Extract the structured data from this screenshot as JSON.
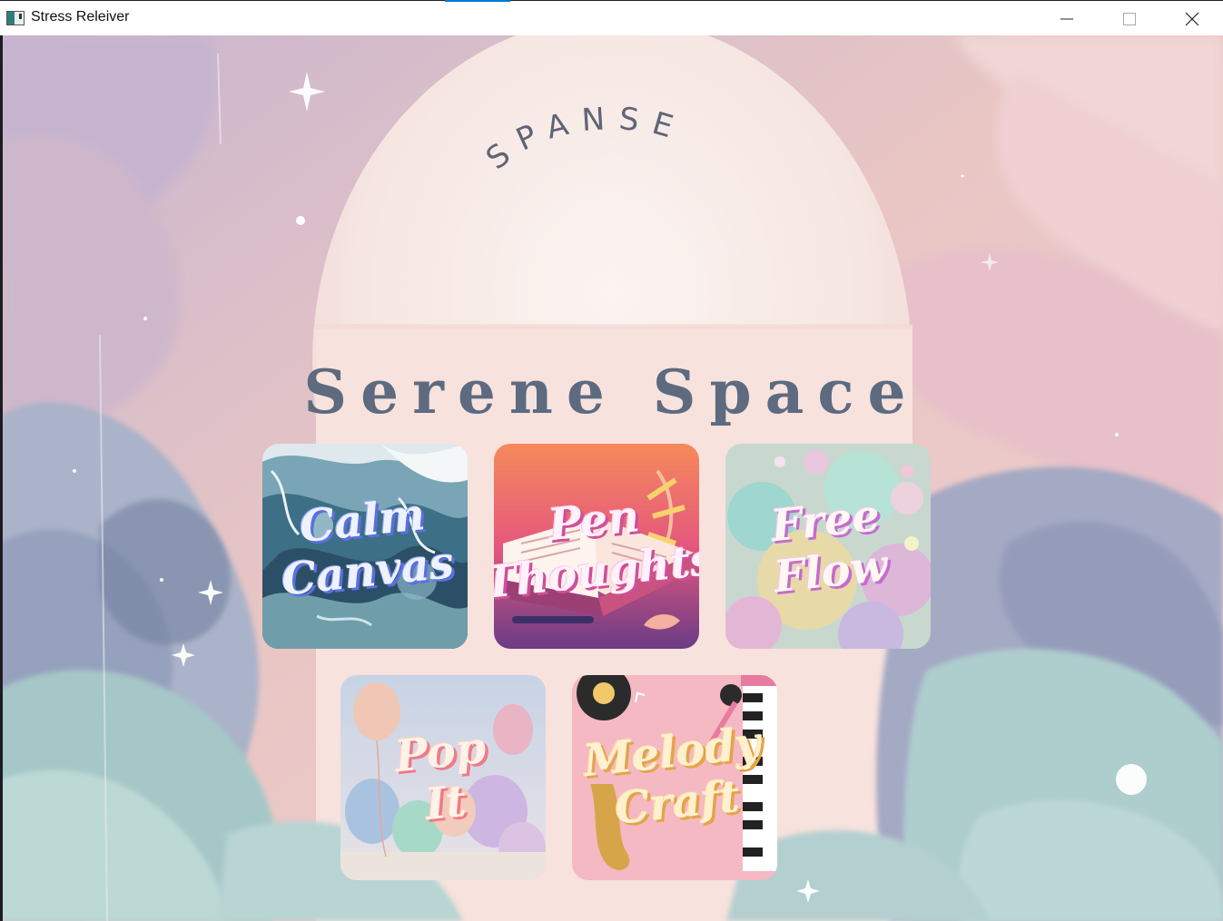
{
  "window": {
    "title": "Stress Releiver",
    "controls": {
      "minimize": "minimize",
      "maximize": "maximize",
      "close": "close"
    }
  },
  "logo": {
    "arc_text": "SPANSE"
  },
  "heading": "Serene Space",
  "cards": [
    {
      "id": "calm-canvas",
      "line1": "Calm",
      "line2": "Canvas",
      "accent": "#5b6fe0"
    },
    {
      "id": "pen-thoughts",
      "line1": "Pen",
      "line2": "Thoughts",
      "accent": "#d14e9a"
    },
    {
      "id": "free-flow",
      "line1": "Free",
      "line2": "Flow",
      "accent": "#c66ad0"
    },
    {
      "id": "pop-it",
      "line1": "Pop",
      "line2": "It",
      "accent": "#f07a86"
    },
    {
      "id": "melody-craft",
      "line1": "Melody",
      "line2": "Craft",
      "accent": "#e4a447"
    }
  ]
}
